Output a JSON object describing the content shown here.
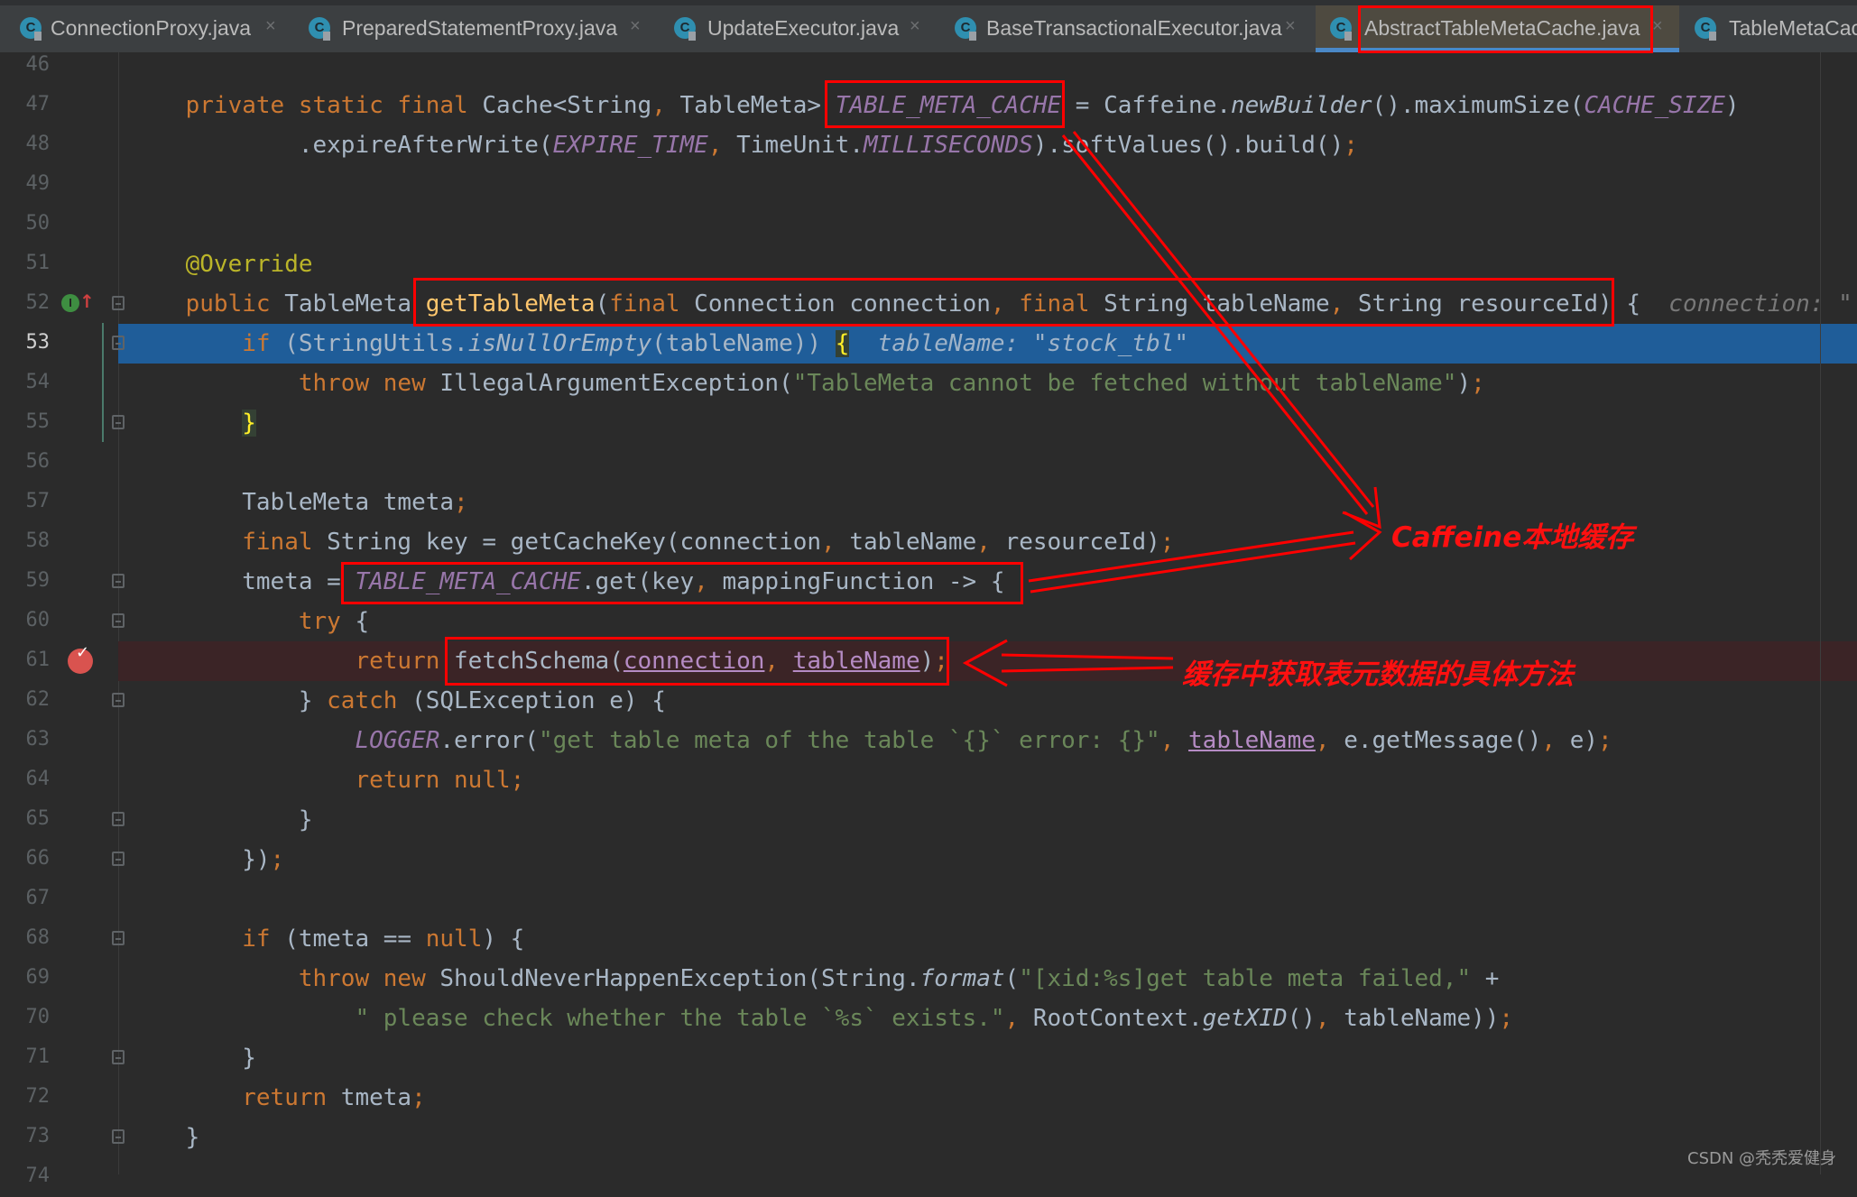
{
  "tabs": [
    {
      "label": "ConnectionProxy.java",
      "icon": "java-class-icon",
      "active": false
    },
    {
      "label": "PreparedStatementProxy.java",
      "icon": "java-class-icon",
      "active": false
    },
    {
      "label": "UpdateExecutor.java",
      "icon": "java-class-icon",
      "active": false
    },
    {
      "label": "BaseTransactionalExecutor.java",
      "icon": "java-class-icon",
      "active": false
    },
    {
      "label": "AbstractTableMetaCache.java",
      "icon": "java-class-icon",
      "active": true
    },
    {
      "label": "TableMetaCac",
      "icon": "java-class-icon",
      "active": false
    }
  ],
  "tab_icon_letter": "C",
  "close_glyph": "×",
  "editor": {
    "current_line": 53,
    "breakpoint_line": 61,
    "lines": [
      {
        "n": "46",
        "tokens": []
      },
      {
        "n": "47",
        "tokens": [
          {
            "t": "    "
          },
          {
            "t": "private static final",
            "k": "kw"
          },
          {
            "t": " Cache<String"
          },
          {
            "t": ",",
            "k": "p"
          },
          {
            "t": " TableMeta> "
          },
          {
            "t": "TABLE_META_CACHE",
            "k": "const"
          },
          {
            "t": " = Caffeine."
          },
          {
            "t": "newBuilder",
            "k": "it"
          },
          {
            "t": "().maximumSize("
          },
          {
            "t": "CACHE_SIZE",
            "k": "const"
          },
          {
            "t": ")"
          }
        ]
      },
      {
        "n": "48",
        "tokens": [
          {
            "t": "            .expireAfterWrite("
          },
          {
            "t": "EXPIRE_TIME",
            "k": "const"
          },
          {
            "t": ", ",
            "k": "p"
          },
          {
            "t": "TimeUnit."
          },
          {
            "t": "MILLISECONDS",
            "k": "const"
          },
          {
            "t": ").softValues().build()"
          },
          {
            "t": ";",
            "k": "p"
          }
        ]
      },
      {
        "n": "49",
        "tokens": []
      },
      {
        "n": "50",
        "tokens": []
      },
      {
        "n": "51",
        "tokens": [
          {
            "t": "    "
          },
          {
            "t": "@Override",
            "k": "anno"
          }
        ]
      },
      {
        "n": "52",
        "tokens": [
          {
            "t": "    "
          },
          {
            "t": "public",
            "k": "kw"
          },
          {
            "t": " TableMeta "
          },
          {
            "t": "getTableMeta",
            "k": "decl"
          },
          {
            "t": "("
          },
          {
            "t": "final",
            "k": "kw"
          },
          {
            "t": " Connection connection"
          },
          {
            "t": ", ",
            "k": "p"
          },
          {
            "t": "final",
            "k": "kw"
          },
          {
            "t": " String tableName"
          },
          {
            "t": ", ",
            "k": "p"
          },
          {
            "t": "String resourceId) {"
          },
          {
            "t": "  connection: \"",
            "k": "hint"
          }
        ]
      },
      {
        "n": "53",
        "tokens": [
          {
            "t": "        "
          },
          {
            "t": "if",
            "k": "kw"
          },
          {
            "t": " (StringUtils."
          },
          {
            "t": "isNullOrEmpty",
            "k": "it"
          },
          {
            "t": "(tableName)) "
          },
          {
            "t": "{",
            "k": "brace"
          },
          {
            "t": "  tableName: \"stock_tbl\"",
            "k": "hint"
          }
        ]
      },
      {
        "n": "54",
        "tokens": [
          {
            "t": "            "
          },
          {
            "t": "throw new",
            "k": "kw"
          },
          {
            "t": " IllegalArgumentException("
          },
          {
            "t": "\"TableMeta cannot be fetched without tableName\"",
            "k": "str"
          },
          {
            "t": ")"
          },
          {
            "t": ";",
            "k": "p"
          }
        ]
      },
      {
        "n": "55",
        "tokens": [
          {
            "t": "        "
          },
          {
            "t": "}",
            "k": "brace"
          }
        ]
      },
      {
        "n": "56",
        "tokens": []
      },
      {
        "n": "57",
        "tokens": [
          {
            "t": "        TableMeta tmeta"
          },
          {
            "t": ";",
            "k": "p"
          }
        ]
      },
      {
        "n": "58",
        "tokens": [
          {
            "t": "        "
          },
          {
            "t": "final",
            "k": "kw"
          },
          {
            "t": " String key = getCacheKey(connection"
          },
          {
            "t": ", ",
            "k": "p"
          },
          {
            "t": "tableName"
          },
          {
            "t": ", ",
            "k": "p"
          },
          {
            "t": "resourceId)"
          },
          {
            "t": ";",
            "k": "p"
          }
        ]
      },
      {
        "n": "59",
        "tokens": [
          {
            "t": "        tmeta = "
          },
          {
            "t": "TABLE_META_CACHE",
            "k": "const"
          },
          {
            "t": ".get(key"
          },
          {
            "t": ", ",
            "k": "p"
          },
          {
            "t": "mappingFunction -> {"
          }
        ]
      },
      {
        "n": "60",
        "tokens": [
          {
            "t": "            "
          },
          {
            "t": "try",
            "k": "kw"
          },
          {
            "t": " {"
          }
        ]
      },
      {
        "n": "61",
        "tokens": [
          {
            "t": "                "
          },
          {
            "t": "return",
            "k": "kw"
          },
          {
            "t": " fetchSchema("
          },
          {
            "t": "connection",
            "k": "ul"
          },
          {
            "t": ", ",
            "k": "p"
          },
          {
            "t": "tableName",
            "k": "ul"
          },
          {
            "t": ")"
          },
          {
            "t": ";",
            "k": "p"
          }
        ]
      },
      {
        "n": "62",
        "tokens": [
          {
            "t": "            } "
          },
          {
            "t": "catch",
            "k": "kw"
          },
          {
            "t": " (SQLException e) {"
          }
        ]
      },
      {
        "n": "63",
        "tokens": [
          {
            "t": "                "
          },
          {
            "t": "LOGGER",
            "k": "const"
          },
          {
            "t": ".error("
          },
          {
            "t": "\"get table meta of the table `{}` error: {}\"",
            "k": "str"
          },
          {
            "t": ", ",
            "k": "p"
          },
          {
            "t": "tableName",
            "k": "ul"
          },
          {
            "t": ", ",
            "k": "p"
          },
          {
            "t": "e.getMessage()"
          },
          {
            "t": ", ",
            "k": "p"
          },
          {
            "t": "e)"
          },
          {
            "t": ";",
            "k": "p"
          }
        ]
      },
      {
        "n": "64",
        "tokens": [
          {
            "t": "                "
          },
          {
            "t": "return null;",
            "k": "kw"
          }
        ]
      },
      {
        "n": "65",
        "tokens": [
          {
            "t": "            }"
          }
        ]
      },
      {
        "n": "66",
        "tokens": [
          {
            "t": "        })"
          },
          {
            "t": ";",
            "k": "p"
          }
        ]
      },
      {
        "n": "67",
        "tokens": []
      },
      {
        "n": "68",
        "tokens": [
          {
            "t": "        "
          },
          {
            "t": "if",
            "k": "kw"
          },
          {
            "t": " (tmeta == "
          },
          {
            "t": "null",
            "k": "kw"
          },
          {
            "t": ") {"
          }
        ]
      },
      {
        "n": "69",
        "tokens": [
          {
            "t": "            "
          },
          {
            "t": "throw new",
            "k": "kw"
          },
          {
            "t": " ShouldNeverHappenException(String."
          },
          {
            "t": "format",
            "k": "it"
          },
          {
            "t": "("
          },
          {
            "t": "\"[xid:%s]get table meta failed,\"",
            "k": "str"
          },
          {
            "t": " +"
          }
        ]
      },
      {
        "n": "70",
        "tokens": [
          {
            "t": "                "
          },
          {
            "t": "\" please check whether the table `%s` exists.\"",
            "k": "str"
          },
          {
            "t": ", ",
            "k": "p"
          },
          {
            "t": "RootContext."
          },
          {
            "t": "getXID",
            "k": "it"
          },
          {
            "t": "()"
          },
          {
            "t": ", ",
            "k": "p"
          },
          {
            "t": "tableName))"
          },
          {
            "t": ";",
            "k": "p"
          }
        ]
      },
      {
        "n": "71",
        "tokens": [
          {
            "t": "        }"
          }
        ]
      },
      {
        "n": "72",
        "tokens": [
          {
            "t": "        "
          },
          {
            "t": "return",
            "k": "kw"
          },
          {
            "t": " tmeta"
          },
          {
            "t": ";",
            "k": "p"
          }
        ]
      },
      {
        "n": "73",
        "tokens": [
          {
            "t": "    }"
          }
        ]
      },
      {
        "n": "74",
        "tokens": []
      }
    ],
    "fold_lines": [
      "52",
      "53",
      "55",
      "59",
      "60",
      "62",
      "65",
      "66",
      "68",
      "71",
      "73"
    ]
  },
  "gutter": {
    "implements_icon_letter": "I",
    "implements_arrow": "↑",
    "breakpoint_check": "✓"
  },
  "annotations": {
    "caffeine_label": "Caffeine本地缓存",
    "fetch_label": "缓存中获取表元数据的具体方法",
    "color": "#ff0000"
  },
  "watermark": "CSDN @秃秃爱健身"
}
